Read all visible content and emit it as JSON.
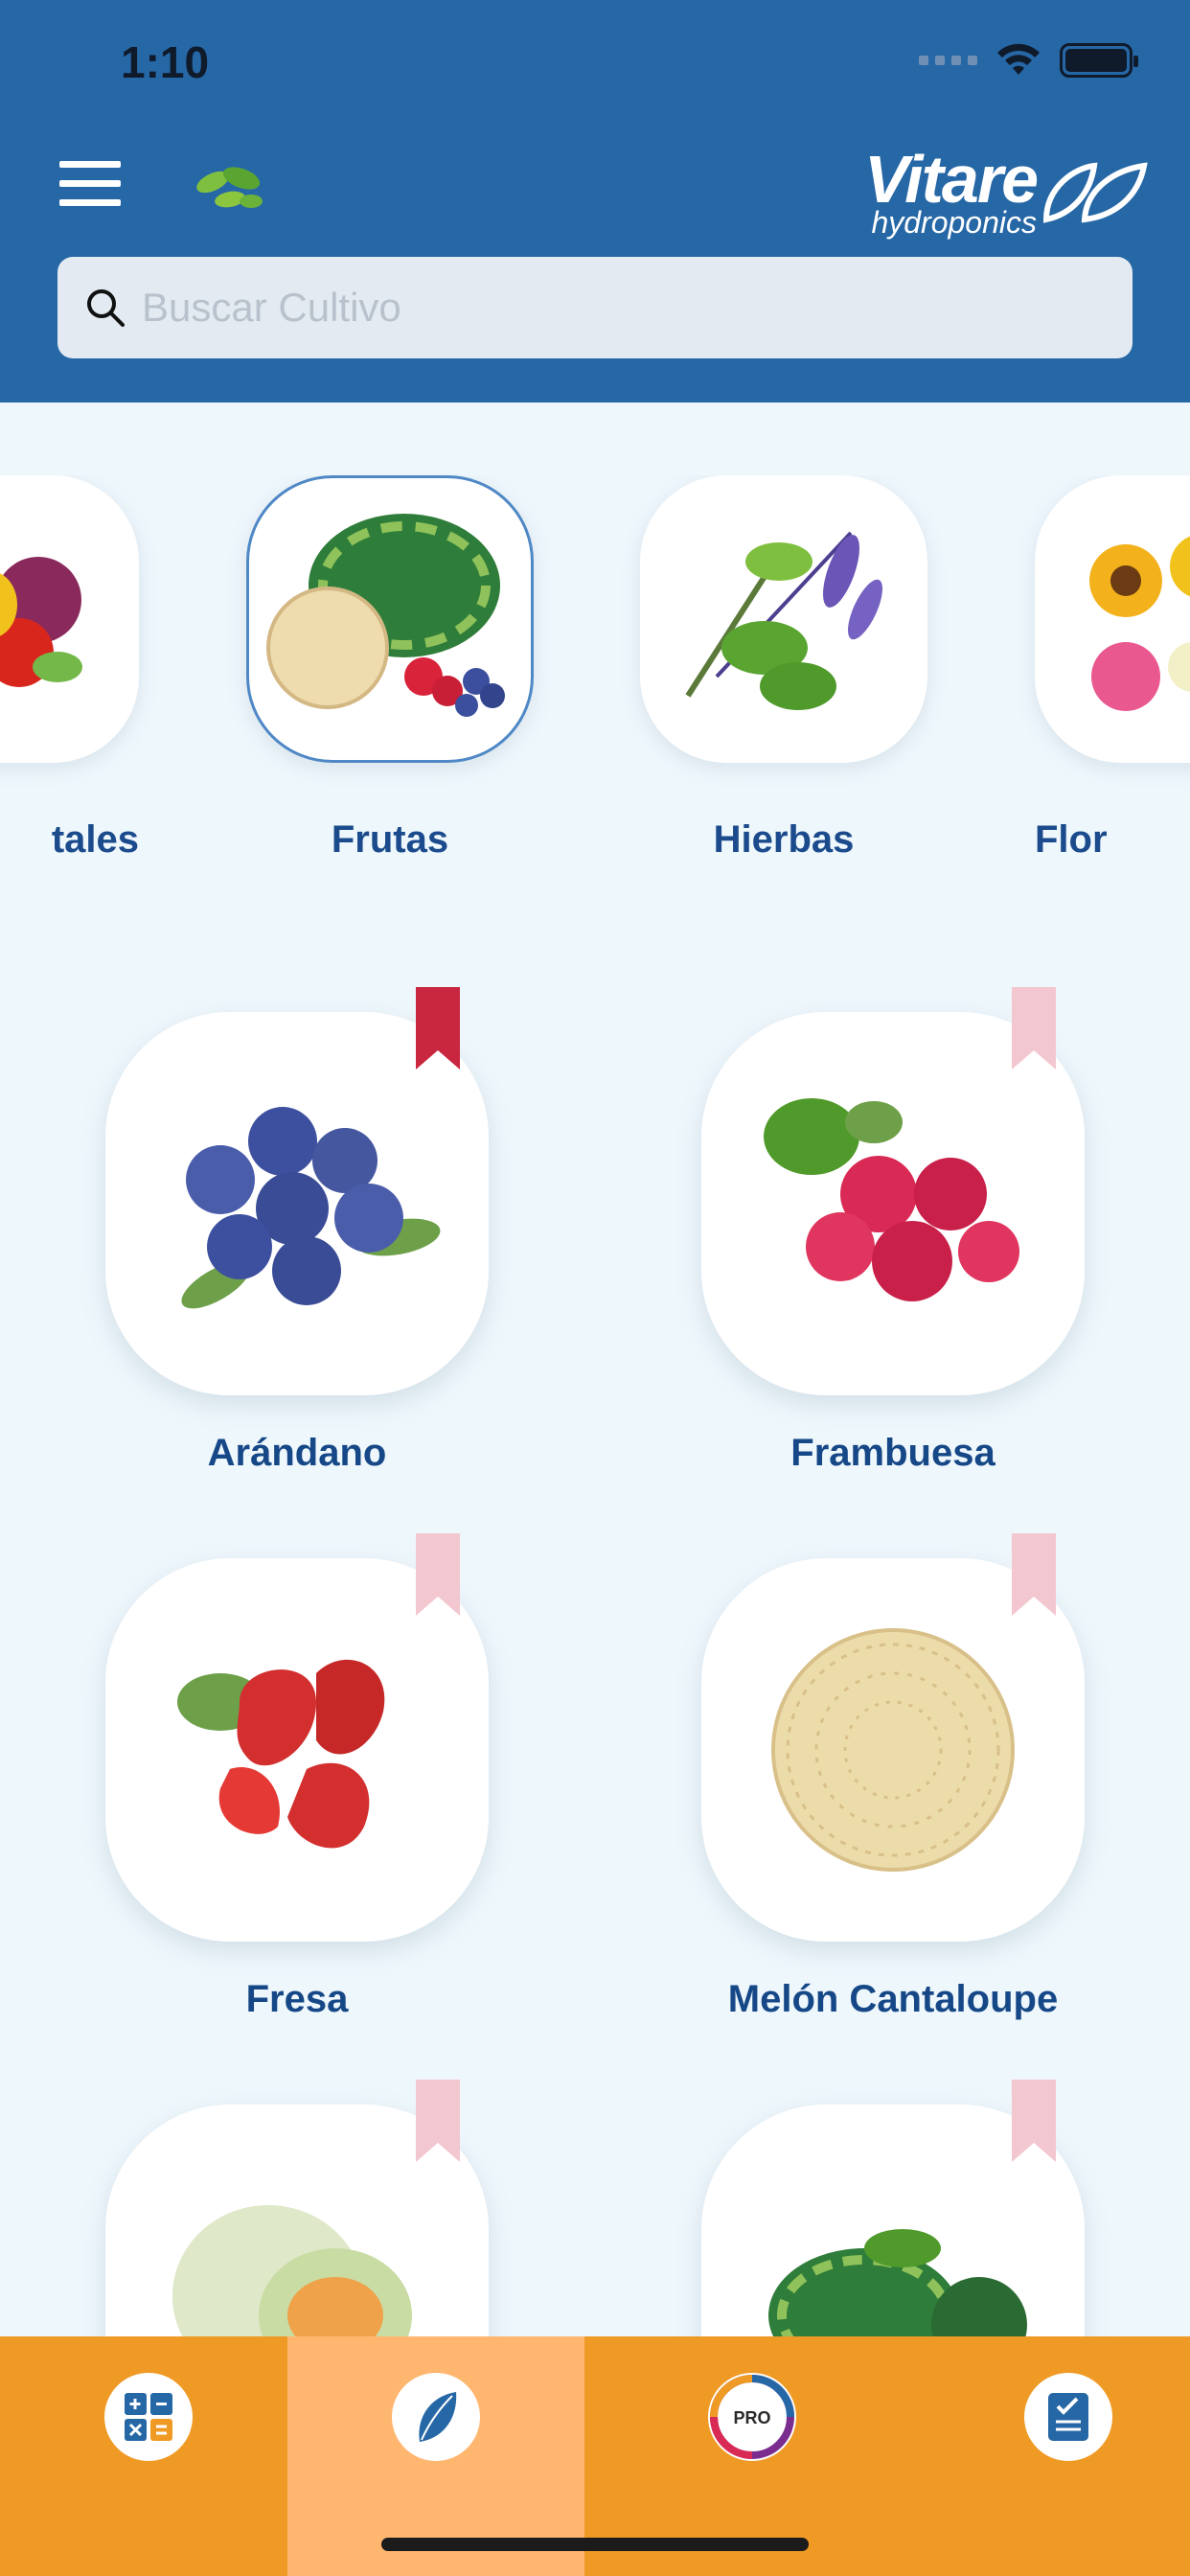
{
  "status_bar": {
    "time": "1:10"
  },
  "header": {
    "brand_main": "Vitare",
    "brand_sub": "hydroponics",
    "search_placeholder": "Buscar Cultivo"
  },
  "categories": [
    {
      "label": "tales",
      "selected": false
    },
    {
      "label": "Frutas",
      "selected": true
    },
    {
      "label": "Hierbas",
      "selected": false
    },
    {
      "label": "Flor",
      "selected": false
    }
  ],
  "crops": [
    {
      "label": "Arándano",
      "bookmarked": true
    },
    {
      "label": "Frambuesa",
      "bookmarked": false
    },
    {
      "label": "Fresa",
      "bookmarked": false
    },
    {
      "label": "Melón Cantaloupe",
      "bookmarked": false
    },
    {
      "label": "",
      "bookmarked": false
    },
    {
      "label": "",
      "bookmarked": false
    }
  ],
  "bottom_tabs": [
    {
      "name": "calculator",
      "active": false
    },
    {
      "name": "crops",
      "active": true
    },
    {
      "name": "pro",
      "active": false,
      "badge": "PRO"
    },
    {
      "name": "notes",
      "active": false
    }
  ],
  "colors": {
    "header": "#2667a6",
    "accent": "#1b4b8c",
    "bottom_bar": "#ef9a25",
    "active_tab": "#ffb66f",
    "bookmark_active": "#c9263f",
    "bookmark_inactive": "#f3c7d0"
  }
}
